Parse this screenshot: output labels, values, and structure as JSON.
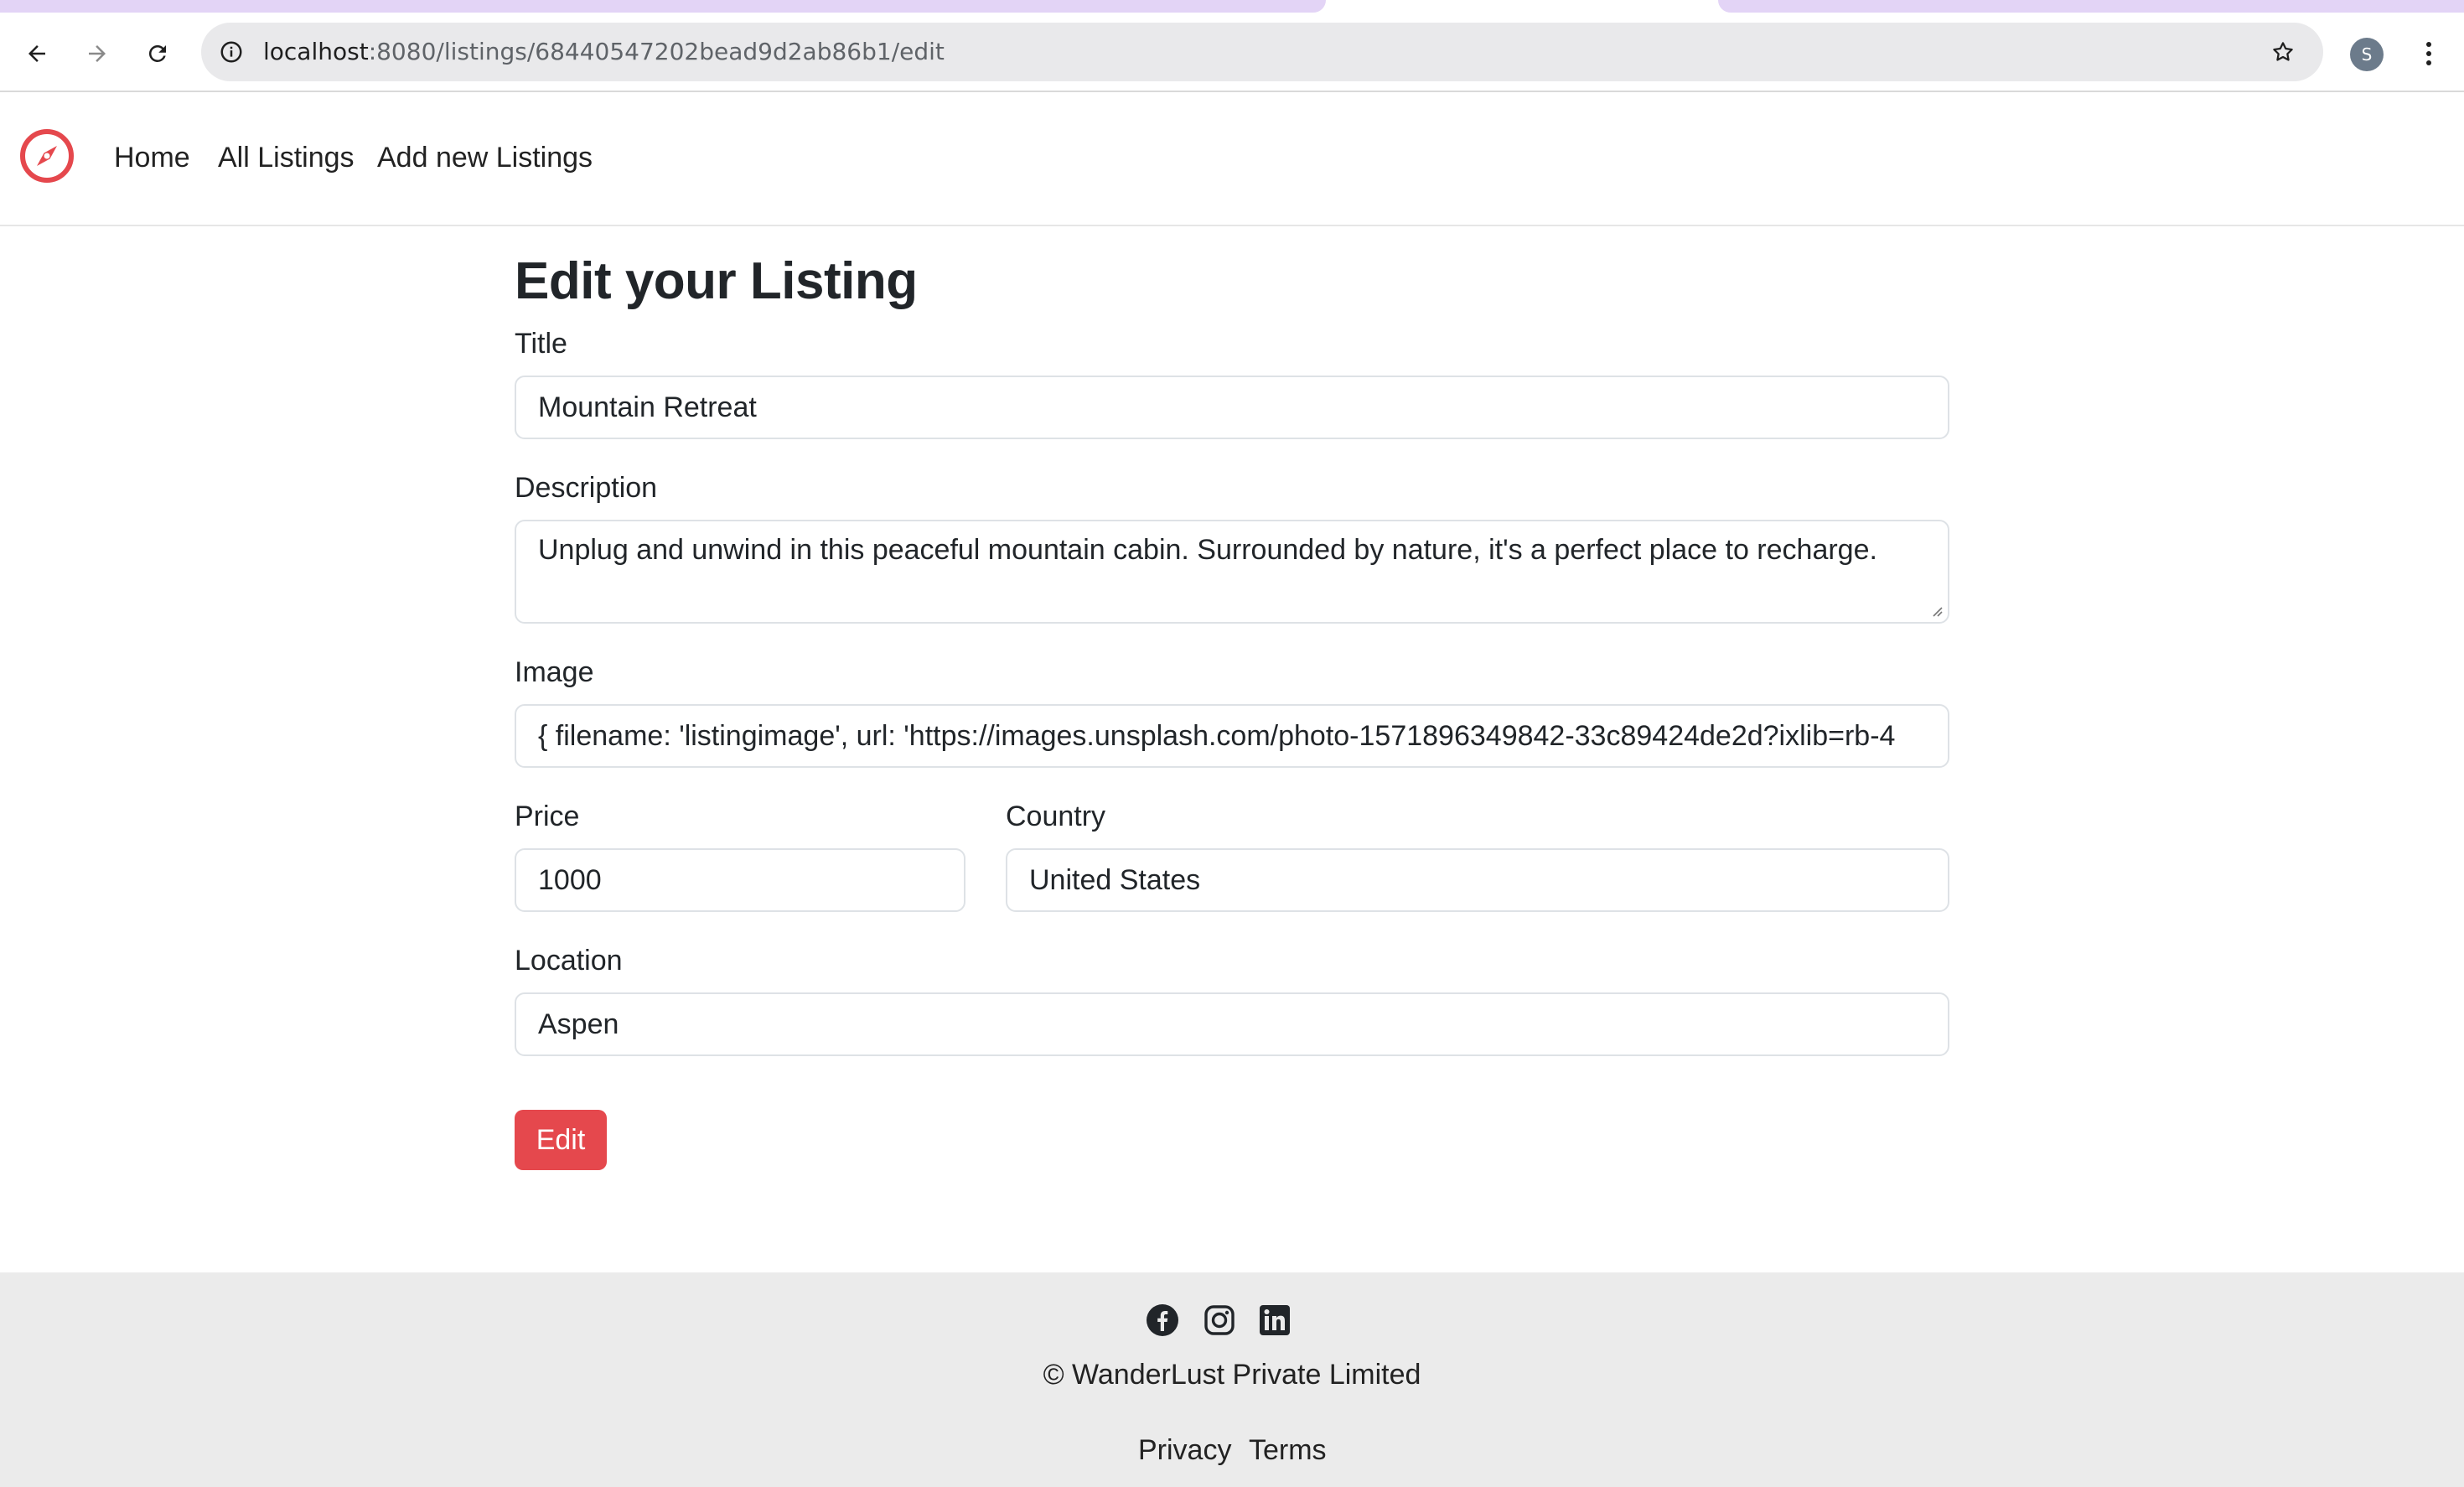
{
  "browser": {
    "url_host": "localhost",
    "url_path": ":8080/listings/68440547202bead9d2ab86b1/edit",
    "profile_initial": "S"
  },
  "navbar": {
    "brand_icon": "compass-icon",
    "brand_color": "#e5484d",
    "links": [
      "Home",
      "All Listings",
      "Add new Listings"
    ]
  },
  "form": {
    "heading": "Edit your Listing",
    "title_label": "Title",
    "title_value": "Mountain Retreat",
    "description_label": "Description",
    "description_value": "Unplug and unwind in this peaceful mountain cabin. Surrounded by nature, it's a perfect place to recharge.",
    "image_label": "Image",
    "image_value": "{ filename: 'listingimage', url: 'https://images.unsplash.com/photo-1571896349842-33c89424de2d?ixlib=rb-4",
    "price_label": "Price",
    "price_value": "1000",
    "country_label": "Country",
    "country_value": "United States",
    "location_label": "Location",
    "location_value": "Aspen",
    "submit_label": "Edit",
    "submit_color": "#e5484d"
  },
  "footer": {
    "social_icons": [
      "facebook-icon",
      "instagram-icon",
      "linkedin-icon"
    ],
    "copyright": "© WanderLust Private Limited",
    "privacy": "Privacy",
    "terms": "Terms"
  }
}
